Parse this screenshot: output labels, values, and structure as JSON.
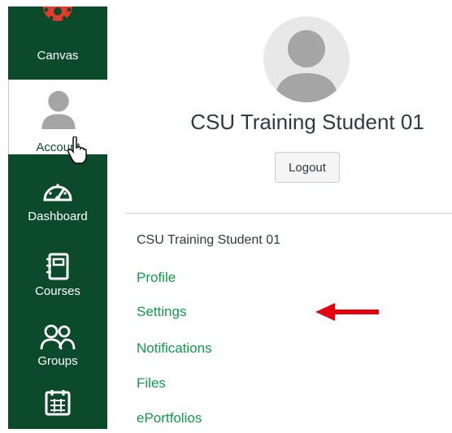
{
  "nav": {
    "items": [
      {
        "label": "Canvas",
        "icon": "canvas-logo-icon"
      },
      {
        "label": "Account",
        "icon": "avatar-icon"
      },
      {
        "label": "Dashboard",
        "icon": "dashboard-gauge-icon"
      },
      {
        "label": "Courses",
        "icon": "courses-book-icon"
      },
      {
        "label": "Groups",
        "icon": "groups-people-icon"
      },
      {
        "label": "",
        "icon": "calendar-icon"
      }
    ],
    "active_item": "Account"
  },
  "account_tray": {
    "user_name": "CSU Training Student 01",
    "logout_label": "Logout",
    "links": [
      {
        "label": "Profile"
      },
      {
        "label": "Settings"
      },
      {
        "label": "Notifications"
      },
      {
        "label": "Files"
      },
      {
        "label": "ePortfolios"
      }
    ]
  },
  "colors": {
    "nav_background": "#0b4a2a",
    "link_color": "#0e9c4a",
    "canvas_logo": "#e23b2c",
    "annotation_arrow": "#e3000f"
  }
}
